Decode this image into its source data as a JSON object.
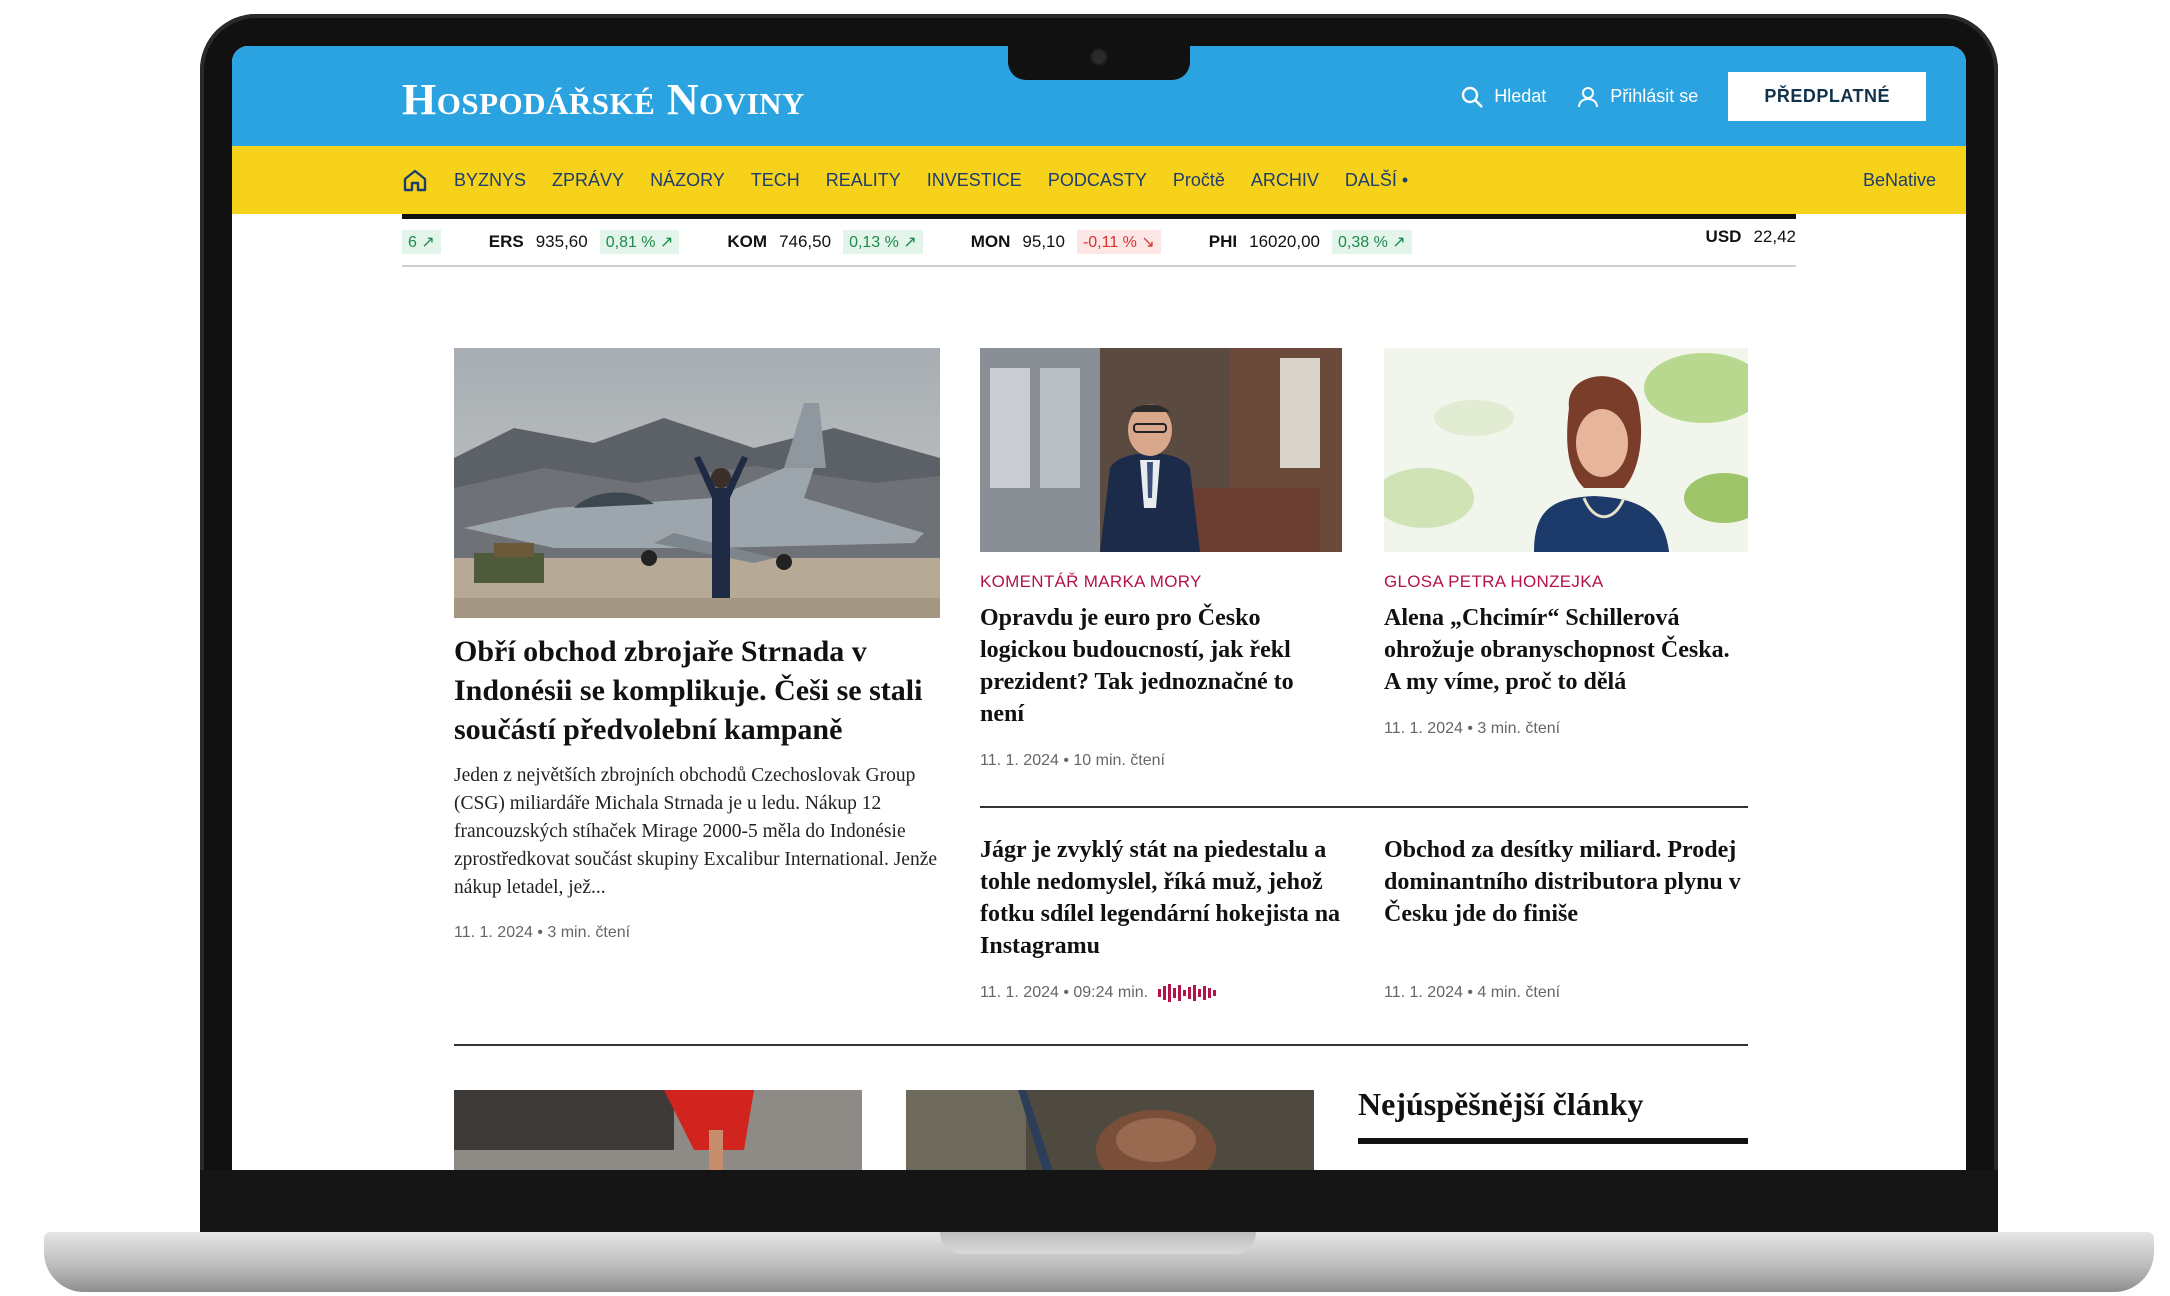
{
  "site": {
    "logo": "Hospodářské Noviny",
    "search_label": "Hledat",
    "login_label": "Přihlásit se",
    "subscribe_label": "PŘEDPLATNÉ"
  },
  "nav": {
    "items": [
      "BYZNYS",
      "ZPRÁVY",
      "NÁZORY",
      "TECH",
      "REALITY",
      "INVESTICE",
      "PODCASTY",
      "Pročtě",
      "ARCHIV",
      "DALŠÍ •"
    ],
    "right": "BeNative"
  },
  "ticker": {
    "items": [
      {
        "sym": "",
        "val": "",
        "chg": "6 ↗",
        "dir": "up"
      },
      {
        "sym": "ERS",
        "val": "935,60",
        "chg": "0,81 % ↗",
        "dir": "up"
      },
      {
        "sym": "KOM",
        "val": "746,50",
        "chg": "0,13 % ↗",
        "dir": "up"
      },
      {
        "sym": "MON",
        "val": "95,10",
        "chg": "-0,11 % ↘",
        "dir": "down"
      },
      {
        "sym": "PHI",
        "val": "16020,00",
        "chg": "0,38 % ↗",
        "dir": "up"
      }
    ],
    "currency": {
      "sym": "USD",
      "val": "22,42"
    }
  },
  "lead": {
    "headline": "Obří obchod zbrojaře Strnada v Indonésii se komplikuje. Češi se stali součástí předvolební kampaně",
    "perex": "Jeden z největších zbrojních obchodů Czechoslovak Group (CSG) miliardáře Michala Strnada je u ledu. Nákup 12 francouzských stíhaček Mirage 2000-5 měla do Indonésie zprostředkovat součást skupiny Excalibur International. Jenže nákup letadel, jež...",
    "meta": "11. 1. 2024 • 3 min. čtení"
  },
  "articles": [
    {
      "label": "KOMENTÁŘ MARKA MORY",
      "headline": "Opravdu je euro pro Česko logickou budoucností, jak řekl prezident? Tak jednoznačné to není",
      "meta": "11. 1. 2024 • 10 min. čtení"
    },
    {
      "label": "GLOSA PETRA HONZEJKA",
      "headline": "Alena „Chcimír“ Schillerová ohrožuje obranyschopnost Česka. A my víme, proč to dělá",
      "meta": "11. 1. 2024 • 3 min. čtení"
    },
    {
      "headline": "Jágr je zvyklý stát na piedestalu a tohle nedomyslel, říká muž, jehož fotku sdílel legendární hokejista na Instagramu",
      "meta": "11. 1. 2024 • 09:24 min."
    },
    {
      "headline": "Obchod za desítky miliard. Prodej dominantního distributora plynu v Česku jde do finiše",
      "meta": "11. 1. 2024 • 4 min. čtení"
    }
  ],
  "most_read": {
    "title": "Nejúspěšnější články"
  },
  "colors": {
    "topbar": "#2aa3e0",
    "navbar": "#f7d21b",
    "label": "#b4124b",
    "up": "#1e8a4c",
    "down": "#d6312d"
  }
}
